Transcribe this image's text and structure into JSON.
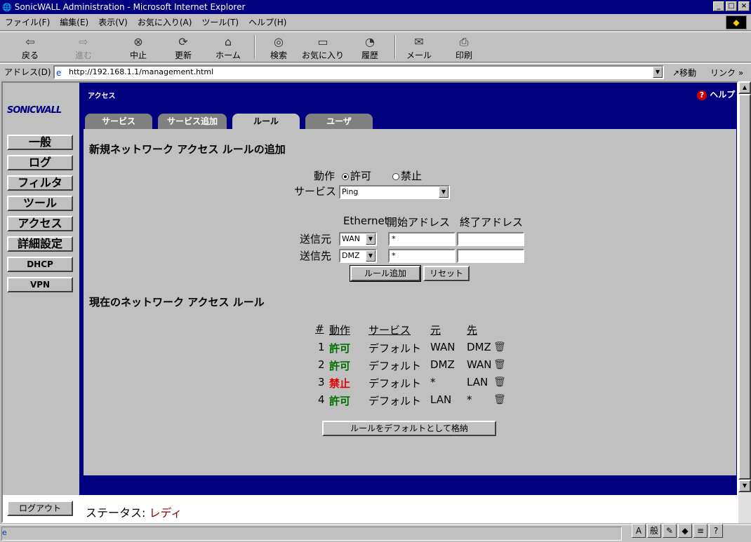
{
  "window": {
    "title": "SonicWALL Administration - Microsoft Internet Explorer",
    "controls": [
      "_",
      "□",
      "×"
    ]
  },
  "menu": [
    "ファイル(F)",
    "編集(E)",
    "表示(V)",
    "お気に入り(A)",
    "ツール(T)",
    "ヘルプ(H)"
  ],
  "toolbar": {
    "back": "戻る",
    "forward": "進む",
    "stop": "中止",
    "refresh": "更新",
    "home": "ホーム",
    "search": "検索",
    "favorites": "お気に入り",
    "history": "履歴",
    "mail": "メール",
    "print": "印刷"
  },
  "address": {
    "label": "アドレス(D)",
    "url": "http://192.168.1.1/management.html",
    "go": "移動",
    "links": "リンク"
  },
  "sidebar": {
    "logo": "SONICWALL",
    "items": [
      {
        "label": "一般"
      },
      {
        "label": "ログ"
      },
      {
        "label": "フィルタ"
      },
      {
        "label": "ツール"
      },
      {
        "label": "アクセス"
      },
      {
        "label": "詳細設定"
      },
      {
        "label": "DHCP"
      },
      {
        "label": "VPN"
      }
    ],
    "logout": "ログアウト"
  },
  "page": {
    "title": "アクセス",
    "help": "ヘルプ"
  },
  "tabs": [
    {
      "label": "サービス"
    },
    {
      "label": "サービス追加"
    },
    {
      "label": "ルール"
    },
    {
      "label": "ユーザ"
    }
  ],
  "new_rule": {
    "heading": "新規ネットワーク アクセス ルールの追加",
    "action_label": "動作",
    "allow": "許可",
    "deny": "禁止",
    "service_label": "サービス",
    "service_value": "Ping",
    "col_ethernet": "Ethernet",
    "col_start": "開始アドレス",
    "col_end": "終了アドレス",
    "source_label": "送信元",
    "source_if": "WAN",
    "source_start": "*",
    "source_end": "",
    "dest_label": "送信先",
    "dest_if": "DMZ",
    "dest_start": "*",
    "dest_end": "",
    "add_button": "ルール追加",
    "reset_button": "リセット"
  },
  "current_rules": {
    "heading": "現在のネットワーク アクセス ルール",
    "headers": {
      "num": "#",
      "action": "動作",
      "service": "サービス",
      "from": "元",
      "to": "先"
    },
    "rows": [
      {
        "num": "1",
        "action": "許可",
        "service": "デフォルト",
        "from": "WAN",
        "to": "DMZ"
      },
      {
        "num": "2",
        "action": "許可",
        "service": "デフォルト",
        "from": "DMZ",
        "to": "WAN"
      },
      {
        "num": "3",
        "action": "禁止",
        "service": "デフォルト",
        "from": "*",
        "to": "LAN"
      },
      {
        "num": "4",
        "action": "許可",
        "service": "デフォルト",
        "from": "LAN",
        "to": "*"
      }
    ],
    "default_button": "ルールをデフォルトとして格納"
  },
  "status": {
    "label": "ステータス:",
    "value": "レディ"
  },
  "colors": {
    "nav": "#000080",
    "allow": "#007000",
    "deny": "#e00000"
  }
}
